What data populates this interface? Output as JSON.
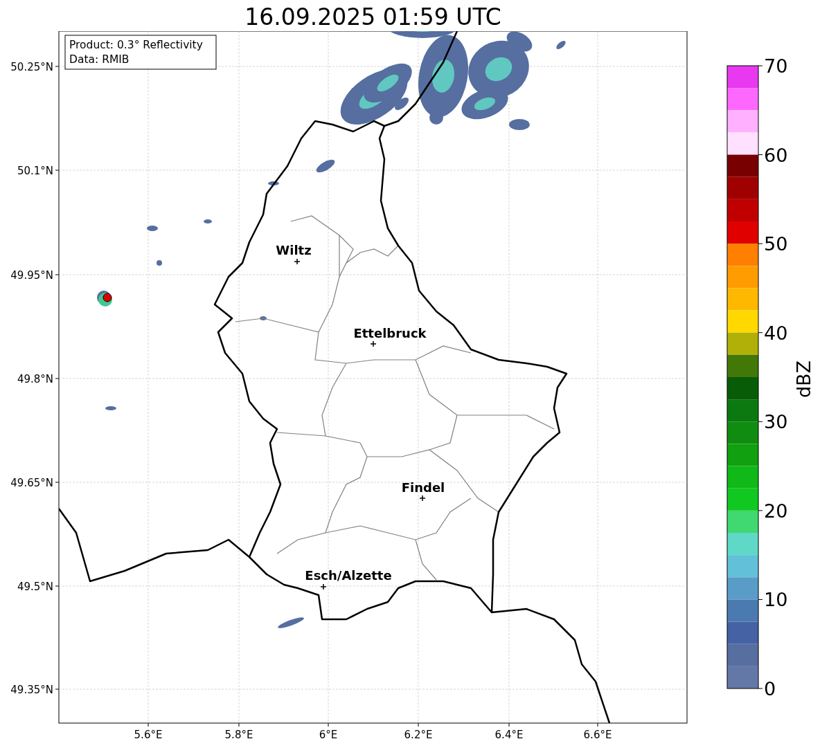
{
  "title": "16.09.2025 01:59 UTC",
  "info_box": {
    "lines": [
      "Product: 0.3° Reflectivity",
      "Data: RMIB"
    ]
  },
  "map": {
    "lat_labels": [
      "50.25°N",
      "50.1°N",
      "49.95°N",
      "49.8°N",
      "49.65°N",
      "49.5°N",
      "49.35°N"
    ],
    "lon_labels": [
      "5.6°E",
      "5.8°E",
      "6°E",
      "6.2°E",
      "6.4°E",
      "6.6°E"
    ],
    "cities": [
      {
        "name": "Wiltz"
      },
      {
        "name": "Ettelbruck"
      },
      {
        "name": "Findel"
      },
      {
        "name": "Esch/Alzette"
      }
    ]
  },
  "colorbar": {
    "label": "dBZ",
    "ticks": [
      "70",
      "60",
      "50",
      "40",
      "30",
      "20",
      "10",
      "0"
    ],
    "bins": [
      {
        "color": "#e838f0"
      },
      {
        "color": "#ff68ff"
      },
      {
        "color": "#ffb0ff"
      },
      {
        "color": "#ffe0ff"
      },
      {
        "color": "#780000"
      },
      {
        "color": "#a00000"
      },
      {
        "color": "#c00000"
      },
      {
        "color": "#e00000"
      },
      {
        "color": "#ff8000"
      },
      {
        "color": "#ff9c00"
      },
      {
        "color": "#ffb800"
      },
      {
        "color": "#ffd800"
      },
      {
        "color": "#b0b008"
      },
      {
        "color": "#427808"
      },
      {
        "color": "#085c08"
      },
      {
        "color": "#0c7810"
      },
      {
        "color": "#108c10"
      },
      {
        "color": "#10a010"
      },
      {
        "color": "#10b818"
      },
      {
        "color": "#10c820"
      },
      {
        "color": "#40d870"
      },
      {
        "color": "#60d8c8"
      },
      {
        "color": "#62c0d8"
      },
      {
        "color": "#5a9cc8"
      },
      {
        "color": "#4a7ab0"
      },
      {
        "color": "#4462a4"
      },
      {
        "color": "#566ea0"
      },
      {
        "color": "#6478a8"
      }
    ]
  }
}
